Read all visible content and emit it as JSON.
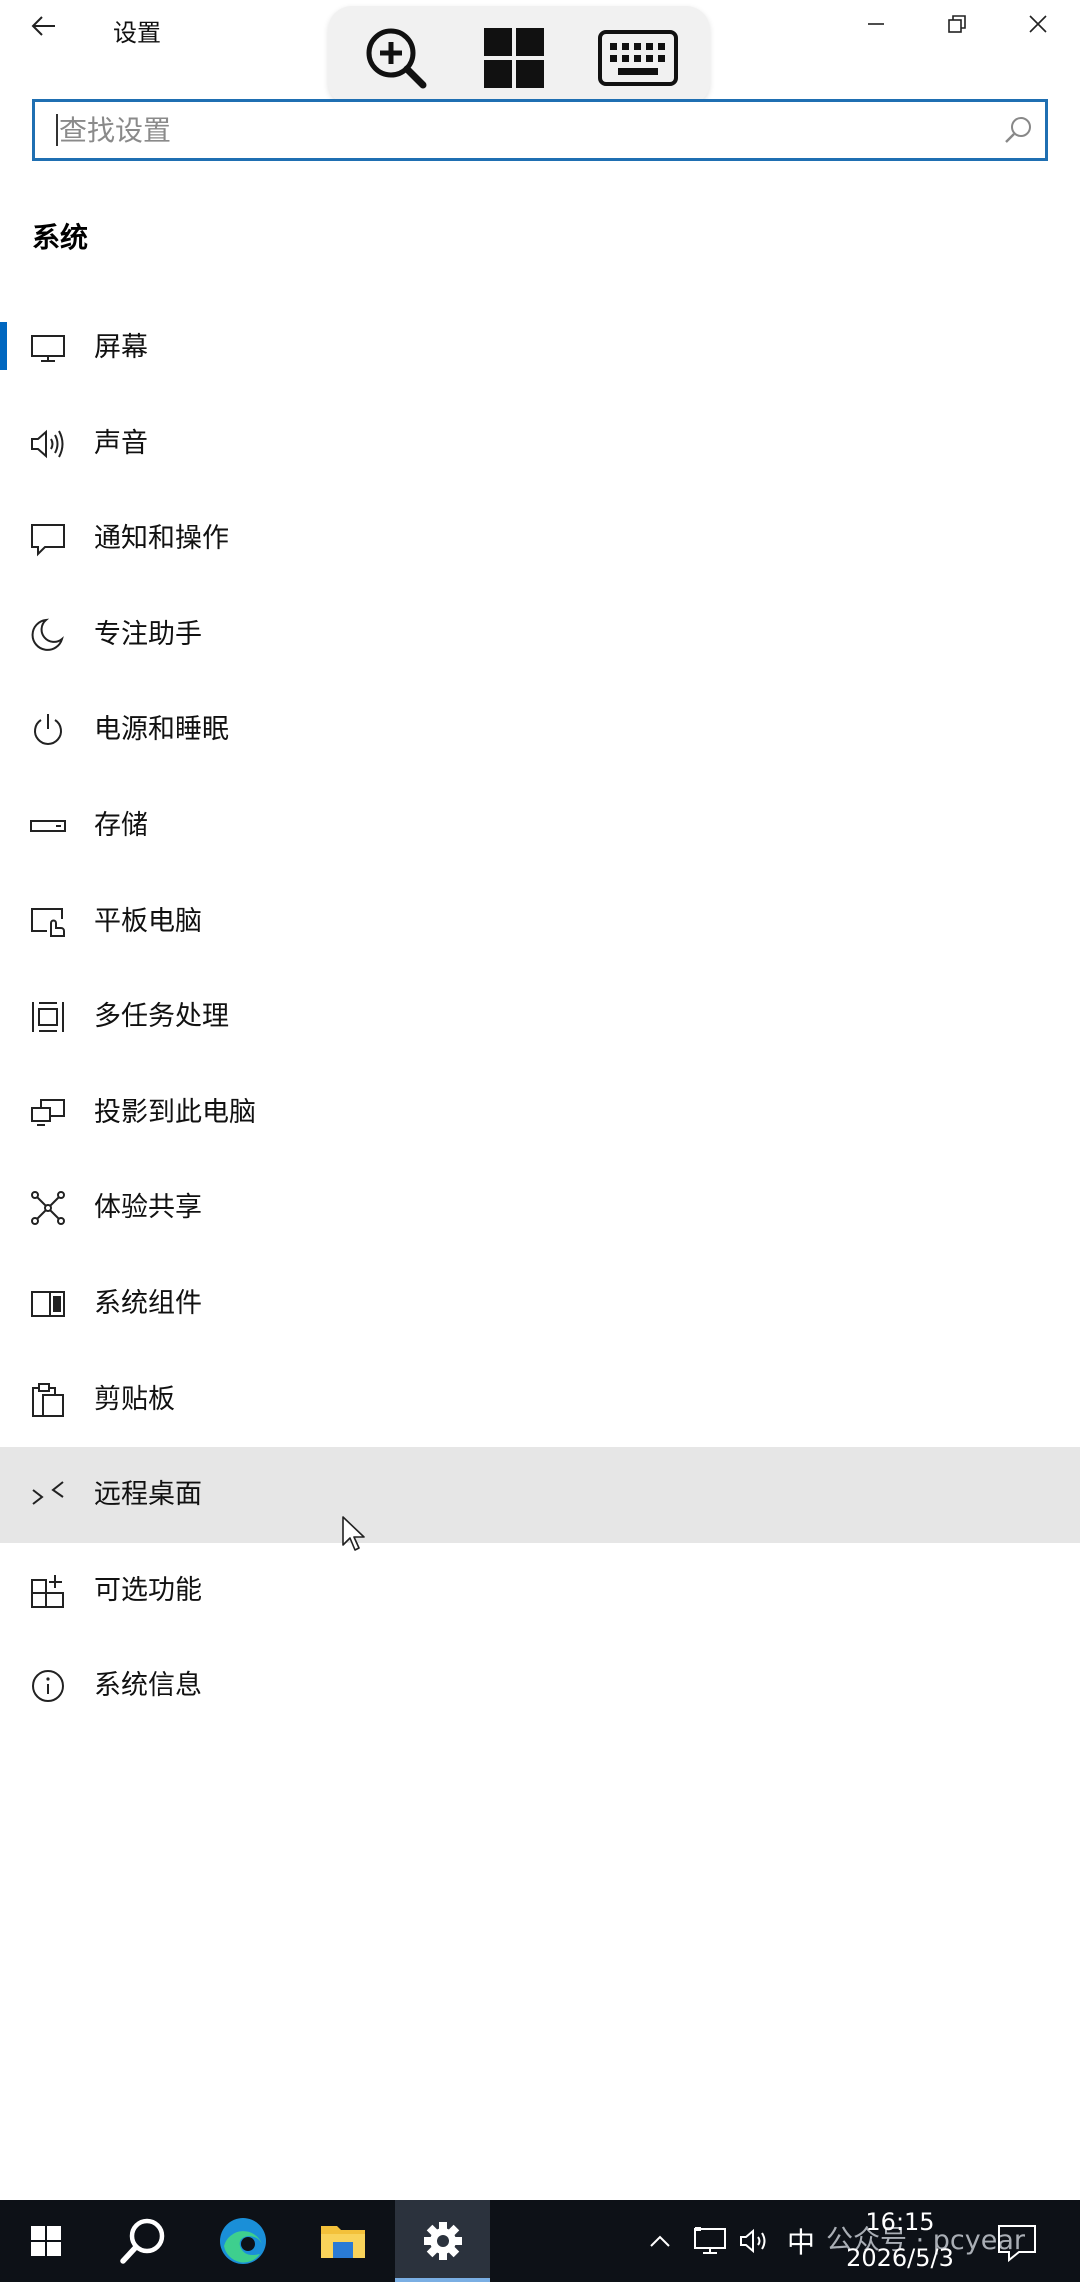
{
  "window": {
    "title": "设置"
  },
  "toolbar": {
    "buttons": [
      "zoom-in-icon",
      "windows-logo-icon",
      "keyboard-icon"
    ]
  },
  "search": {
    "placeholder": "查找设置",
    "value": ""
  },
  "section": {
    "title": "系统"
  },
  "nav": {
    "items": [
      {
        "label": "屏幕",
        "icon": "display-icon",
        "selected": true
      },
      {
        "label": "声音",
        "icon": "speaker-icon"
      },
      {
        "label": "通知和操作",
        "icon": "notification-icon"
      },
      {
        "label": "专注助手",
        "icon": "moon-icon"
      },
      {
        "label": "电源和睡眠",
        "icon": "power-icon"
      },
      {
        "label": "存储",
        "icon": "storage-drive-icon"
      },
      {
        "label": "平板电脑",
        "icon": "tablet-touch-icon"
      },
      {
        "label": "多任务处理",
        "icon": "multitasking-icon"
      },
      {
        "label": "投影到此电脑",
        "icon": "project-icon"
      },
      {
        "label": "体验共享",
        "icon": "shared-experience-icon"
      },
      {
        "label": "系统组件",
        "icon": "system-components-icon"
      },
      {
        "label": "剪贴板",
        "icon": "clipboard-icon"
      },
      {
        "label": "远程桌面",
        "icon": "remote-desktop-icon",
        "hovered": true
      },
      {
        "label": "可选功能",
        "icon": "optional-features-icon"
      },
      {
        "label": "系统信息",
        "icon": "info-icon"
      }
    ]
  },
  "taskbar": {
    "ime": "中",
    "watermark": "公众号 · pcyear",
    "time": "16:15",
    "date": "2026/5/3"
  },
  "colors": {
    "accent": "#0067c0",
    "search_border": "#1f6fb2",
    "hover_bg": "#e6e6e6",
    "taskbar_bg": "#0d1117"
  }
}
